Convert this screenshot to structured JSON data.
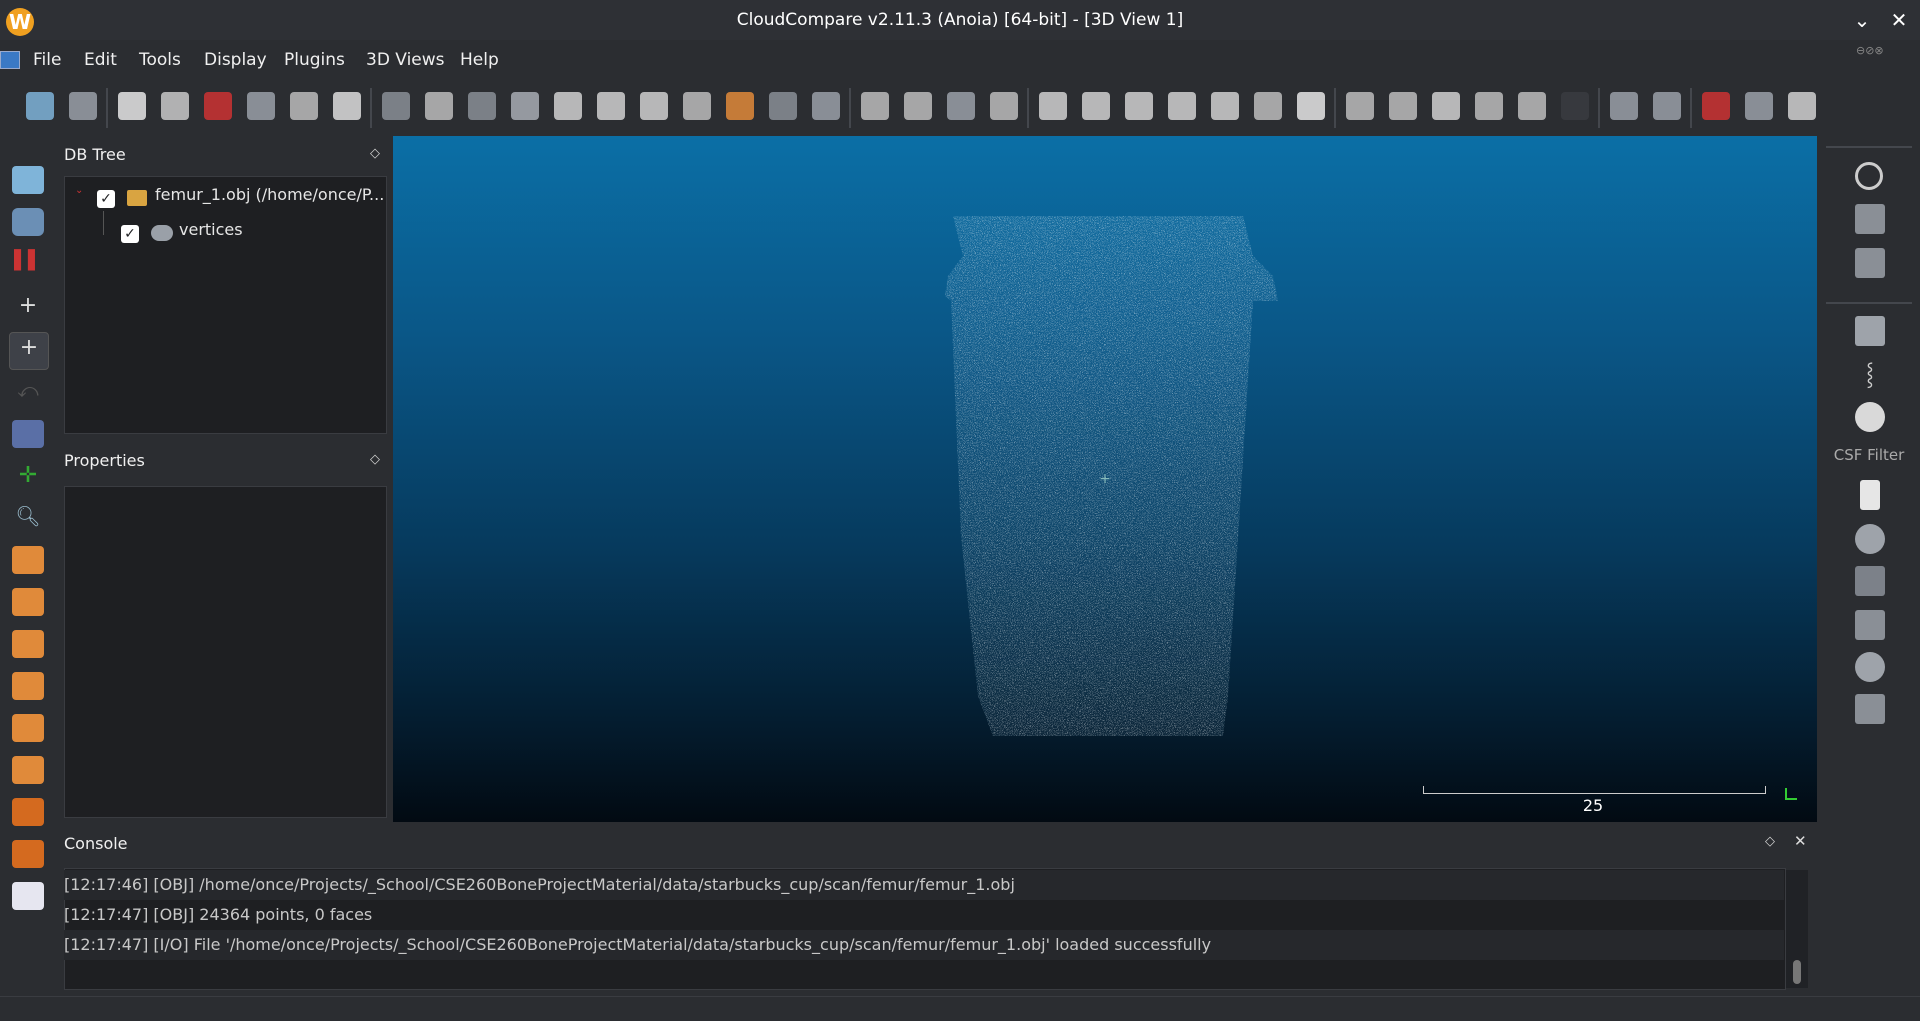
{
  "window": {
    "title": "CloudCompare v2.11.3 (Anoia) [64-bit] - [3D View 1]",
    "logo_letter": "W"
  },
  "menu": [
    "File",
    "Edit",
    "Tools",
    "Display",
    "Plugins",
    "3D Views",
    "Help"
  ],
  "db_tree": {
    "title": "DB Tree",
    "items": [
      {
        "label": "femur_1.obj (/home/once/P...",
        "checked": true,
        "icon": "folder-icon"
      },
      {
        "label": "vertices",
        "checked": true,
        "icon": "point-cloud-icon"
      }
    ]
  },
  "properties": {
    "title": "Properties"
  },
  "view3d": {
    "scale_label": "25"
  },
  "right_toolbar": {
    "csf_label": "CSF Filter"
  },
  "toolbar_icons": [
    "open-icon",
    "save-icon",
    "settings-icon",
    "list-icon",
    "pick-icon",
    "clone-icon",
    "merge-icon",
    "delete-icon",
    "sample-icon",
    "normals-icon",
    "subsample-icon",
    "mesh-icon",
    "noise-icon",
    "filter-icon",
    "density-icon",
    "cc-icon",
    "bucket-icon",
    "checker-icon",
    "sor-icon",
    "segment-icon",
    "translate-icon",
    "plane-icon",
    "align-icon",
    "histogram-icon",
    "graph-icon",
    "align2-icon",
    "compute-icon",
    "plus-icon",
    "calculator-icon",
    "sf-icon",
    "cloud1-icon",
    "cloud2-icon",
    "doc1-icon",
    "doc2-icon",
    "sphere-icon",
    "dark-icon",
    "m3c2-icon",
    "mls-icon",
    "curve-icon",
    "path-icon",
    "undo-icon"
  ],
  "console": {
    "title": "Console",
    "lines": [
      "[12:17:46] [OBJ] /home/once/Projects/_School/CSE260BoneProjectMaterial/data/starbucks_cup/scan/femur/femur_1.obj",
      "[12:17:47] [OBJ] 24364 points, 0 faces",
      "[12:17:47] [I/O] File '/home/once/Projects/_School/CSE260BoneProjectMaterial/data/starbucks_cup/scan/femur/femur_1.obj' loaded successfully"
    ]
  },
  "colors": {
    "accent": "#f0a020",
    "view_top": "#0b6fa6",
    "view_bottom": "#020a12"
  }
}
